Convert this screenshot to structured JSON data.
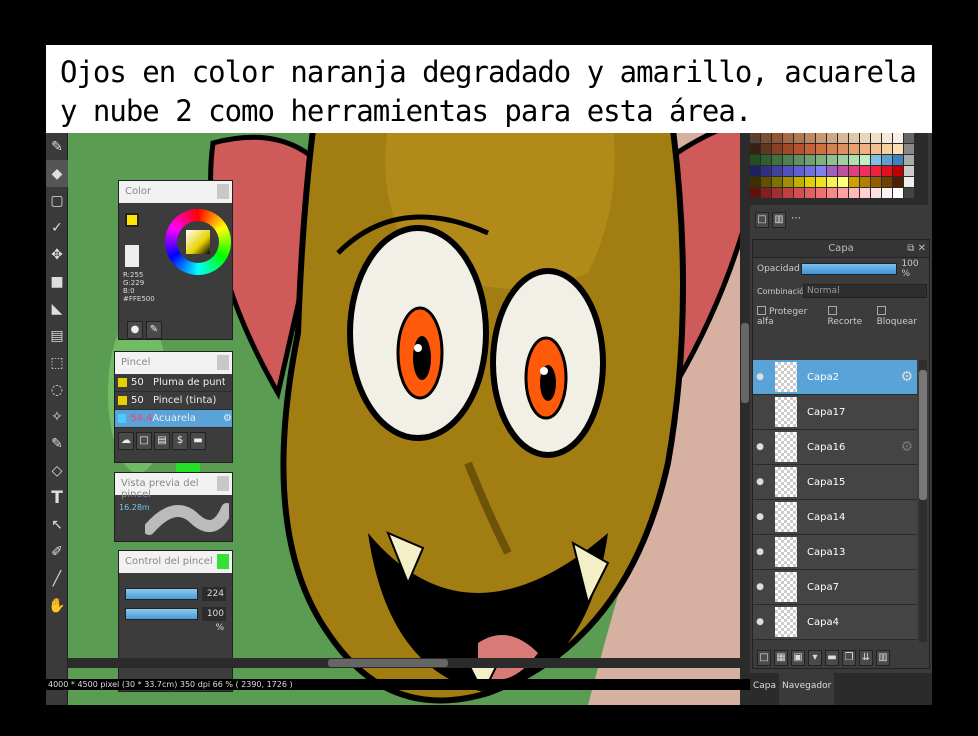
{
  "caption": {
    "line1": "Ojos en color naranja degradado y amarillo, acuarela",
    "line2": "y nube 2 como herramientas para esta área."
  },
  "tools": [
    "pen-icon",
    "eraser-icon",
    "select-rect-icon",
    "brush-icon",
    "move-icon",
    "fill-rect-icon",
    "bucket-icon",
    "gradient-icon",
    "lasso-rect-icon",
    "lasso-icon",
    "wand-icon",
    "edit-select-icon",
    "eraser-select-icon",
    "text-icon",
    "operation-icon",
    "eyedropper-icon",
    "dropper-icon",
    "hand-icon"
  ],
  "color_panel": {
    "title": "Color",
    "rgb": [
      "R:255",
      "G:229",
      "B:0",
      "#FFE500"
    ],
    "main_color": "#FFE500",
    "sub_color": "#5500FF"
  },
  "brush_panel": {
    "title": "Pincel",
    "brushes": [
      {
        "size": "50",
        "name": "Pluma de punteado",
        "color": "#e8d000"
      },
      {
        "size": "50",
        "name": "Pincel (tinta)",
        "color": "#e8d000"
      },
      {
        "size": "54.4",
        "name": "Acuarela",
        "color": "#4fc8ff"
      }
    ]
  },
  "preview_panel": {
    "title": "Vista previa del pincel",
    "size": "16.28m"
  },
  "control_panel": {
    "title": "Control del pincel",
    "size_value": "224",
    "opacity_value": "100 %"
  },
  "layer_panel": {
    "title": "Capa",
    "opacity_label": "Opacidad",
    "opacity_value": "100 %",
    "blend_label": "Combinación",
    "blend_value": "Normal",
    "protect_alpha": "Proteger alfa",
    "clipping": "Recorte",
    "lock": "Bloquear",
    "layers": [
      {
        "name": "Capa2",
        "selected": true
      },
      {
        "name": "Capa17",
        "selected": false
      },
      {
        "name": "Capa16",
        "selected": false
      },
      {
        "name": "Capa15",
        "selected": false
      },
      {
        "name": "Capa14",
        "selected": false
      },
      {
        "name": "Capa13",
        "selected": false
      },
      {
        "name": "Capa7",
        "selected": false
      },
      {
        "name": "Capa4",
        "selected": false
      }
    ]
  },
  "right_tabs": [
    "Capa",
    "Navegador"
  ],
  "status_bar": "4000 * 4500 pixel  (30 * 33.7cm)  350 dpi  66 %  ( 2390, 1726 )",
  "palette_colors": [
    [
      "#5a4030",
      "#7a5030",
      "#905830",
      "#a86a40",
      "#b07850",
      "#c08860",
      "#c89870",
      "#d0a888",
      "#d8b898",
      "#e0c8a8",
      "#e8d8b8",
      "#f0e0c8",
      "#f4e8d8",
      "#f8f0e8",
      "#666666"
    ],
    [
      "#3a2010",
      "#603820",
      "#884020",
      "#a04828",
      "#b85030",
      "#c86038",
      "#d07040",
      "#d88050",
      "#e09060",
      "#e8a070",
      "#f0b080",
      "#f4c090",
      "#f8d0a0",
      "#fce0b0",
      "#888888"
    ],
    [
      "#205020",
      "#306030",
      "#407040",
      "#508050",
      "#609060",
      "#70a070",
      "#80b080",
      "#90c090",
      "#a0d0a0",
      "#b0e0b0",
      "#c0f0c0",
      "#80c0e0",
      "#60a0d0",
      "#4080c0",
      "#aaaaaa"
    ],
    [
      "#202060",
      "#303080",
      "#4040a0",
      "#5050c0",
      "#6060d0",
      "#7070e0",
      "#8080f0",
      "#a060c0",
      "#c050a0",
      "#e04080",
      "#f03060",
      "#f02040",
      "#e01020",
      "#c00000",
      "#cccccc"
    ],
    [
      "#403000",
      "#605000",
      "#807000",
      "#a09000",
      "#c0b000",
      "#e0d000",
      "#f0e020",
      "#f8f050",
      "#ffff80",
      "#d0a000",
      "#b08000",
      "#906000",
      "#704000",
      "#502000",
      "#eeeeee"
    ],
    [
      "#601010",
      "#802020",
      "#a03030",
      "#c04040",
      "#d05050",
      "#e06060",
      "#f07070",
      "#f88888",
      "#ffa0a0",
      "#ffb8b8",
      "#ffd0d0",
      "#ffe0e0",
      "#fff0f0",
      "#ffffff",
      "#444444"
    ]
  ]
}
